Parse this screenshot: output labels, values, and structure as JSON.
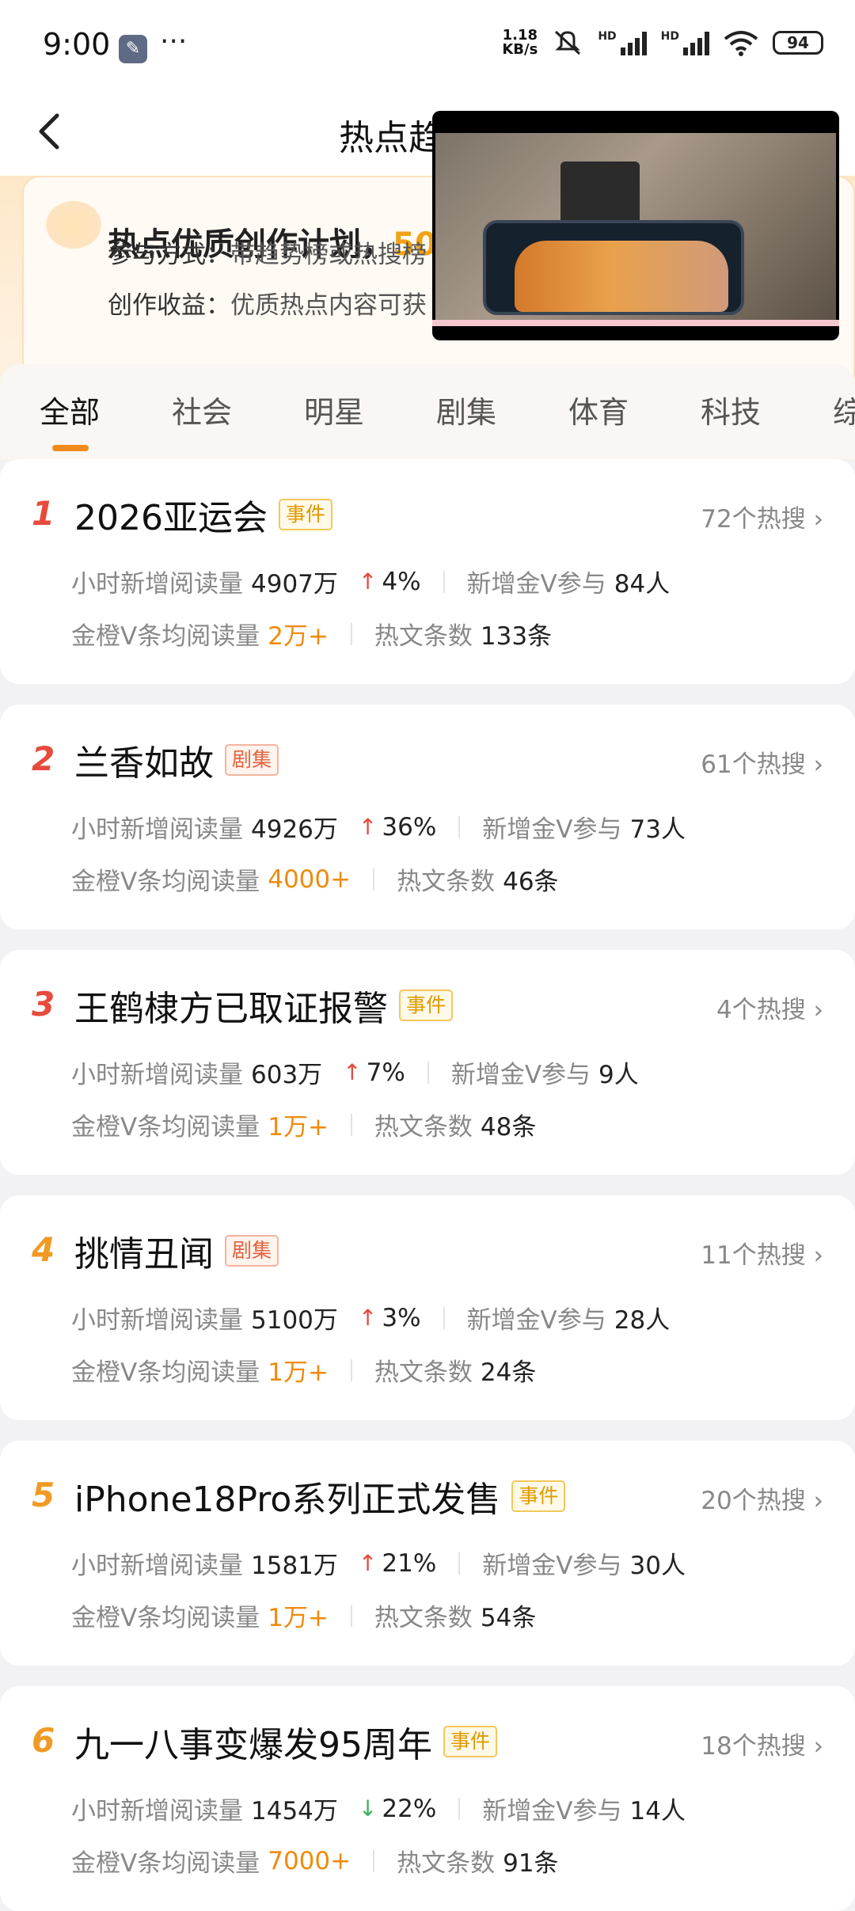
{
  "status_bar": {
    "time": "9:00",
    "net_speed_value": "1.18",
    "net_speed_unit": "KB/s",
    "battery": "94",
    "icons": [
      "wrench-icon",
      "more-dots-icon",
      "mute-icon",
      "signal-icon",
      "signal-icon",
      "wifi-icon",
      "battery-icon"
    ]
  },
  "header": {
    "title": "热点趋",
    "back_icon": "chevron-left-icon"
  },
  "banner": {
    "title_prefix": "热点优质创作计划，",
    "title_highlight": "50",
    "join_label": "参与方式：",
    "join_value": "带趋势榜或热搜榜",
    "earn_label": "创作收益：",
    "earn_value": "优质热点内容可获",
    "highlight_color": "#f1a216"
  },
  "tabs": [
    "全部",
    "社会",
    "明星",
    "剧集",
    "体育",
    "科技",
    "综"
  ],
  "active_tab": "全部",
  "labels": {
    "hourly_reads": "小时新增阅读量",
    "new_v": "新增金V参与",
    "avg_reads": "金橙V条均阅读量",
    "articles": "热文条数"
  },
  "topics": [
    {
      "rank": "1",
      "title": "2026亚运会",
      "tag": "事件",
      "tag_type": "event",
      "hot": "72个热搜",
      "hourly": "4907万",
      "trend": "up",
      "pct": "4%",
      "new_v": "84人",
      "avg": "2万+",
      "articles": "133条"
    },
    {
      "rank": "2",
      "title": "兰香如故",
      "tag": "剧集",
      "tag_type": "drama",
      "hot": "61个热搜",
      "hourly": "4926万",
      "trend": "up",
      "pct": "36%",
      "new_v": "73人",
      "avg": "4000+",
      "articles": "46条"
    },
    {
      "rank": "3",
      "title": "王鹤棣方已取证报警",
      "tag": "事件",
      "tag_type": "event",
      "hot": "4个热搜",
      "hourly": "603万",
      "trend": "up",
      "pct": "7%",
      "new_v": "9人",
      "avg": "1万+",
      "articles": "48条"
    },
    {
      "rank": "4",
      "title": "挑情丑闻",
      "tag": "剧集",
      "tag_type": "drama",
      "hot": "11个热搜",
      "hourly": "5100万",
      "trend": "up",
      "pct": "3%",
      "new_v": "28人",
      "avg": "1万+",
      "articles": "24条"
    },
    {
      "rank": "5",
      "title": "iPhone18Pro系列正式发售",
      "tag": "事件",
      "tag_type": "event",
      "hot": "20个热搜",
      "hourly": "1581万",
      "trend": "up",
      "pct": "21%",
      "new_v": "30人",
      "avg": "1万+",
      "articles": "54条"
    },
    {
      "rank": "6",
      "title": "九一八事变爆发95周年",
      "tag": "事件",
      "tag_type": "event",
      "hot": "18个热搜",
      "hourly": "1454万",
      "trend": "down",
      "pct": "22%",
      "new_v": "14人",
      "avg": "7000+",
      "articles": "91条"
    }
  ],
  "colors": {
    "rank_top": "#e64b3c",
    "rank_other": "#f09a24",
    "trend_up": "#e64b3c",
    "trend_down": "#3db060",
    "avg_value": "#ef8b0f",
    "tab_underline": "#f08a1d"
  }
}
